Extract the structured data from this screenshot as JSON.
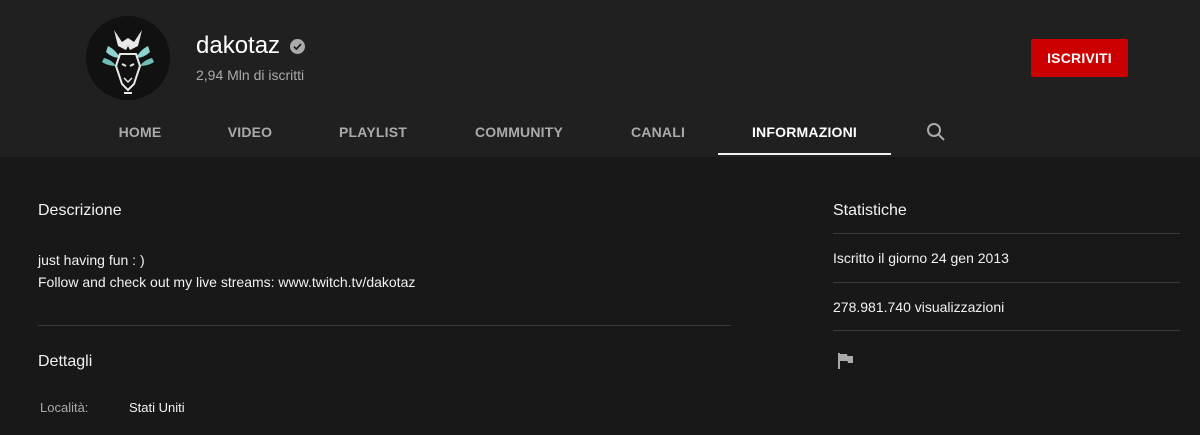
{
  "channel": {
    "name": "dakotaz",
    "subscribers": "2,94 Mln di iscritti",
    "subscribe_label": "ISCRIVITI"
  },
  "tabs": [
    {
      "label": "HOME"
    },
    {
      "label": "VIDEO"
    },
    {
      "label": "PLAYLIST"
    },
    {
      "label": "COMMUNITY"
    },
    {
      "label": "CANALI"
    },
    {
      "label": "INFORMAZIONI"
    }
  ],
  "active_tab": "INFORMAZIONI",
  "about": {
    "description_title": "Descrizione",
    "description_lines": [
      "just having fun : )",
      "Follow and check out my live streams: www.twitch.tv/dakotaz"
    ],
    "details_title": "Dettagli",
    "details": [
      {
        "label": "Località:",
        "value": "Stati Uniti"
      }
    ]
  },
  "stats": {
    "title": "Statistiche",
    "joined": "Iscritto il giorno 24 gen 2013",
    "views": "278.981.740 visualizzazioni"
  },
  "colors": {
    "header_bg": "#202020",
    "page_bg": "#181818",
    "subscribe_bg": "#cc0000"
  },
  "icons": [
    "channel-avatar-icon",
    "verified-check-icon",
    "search-icon",
    "flag-icon"
  ]
}
